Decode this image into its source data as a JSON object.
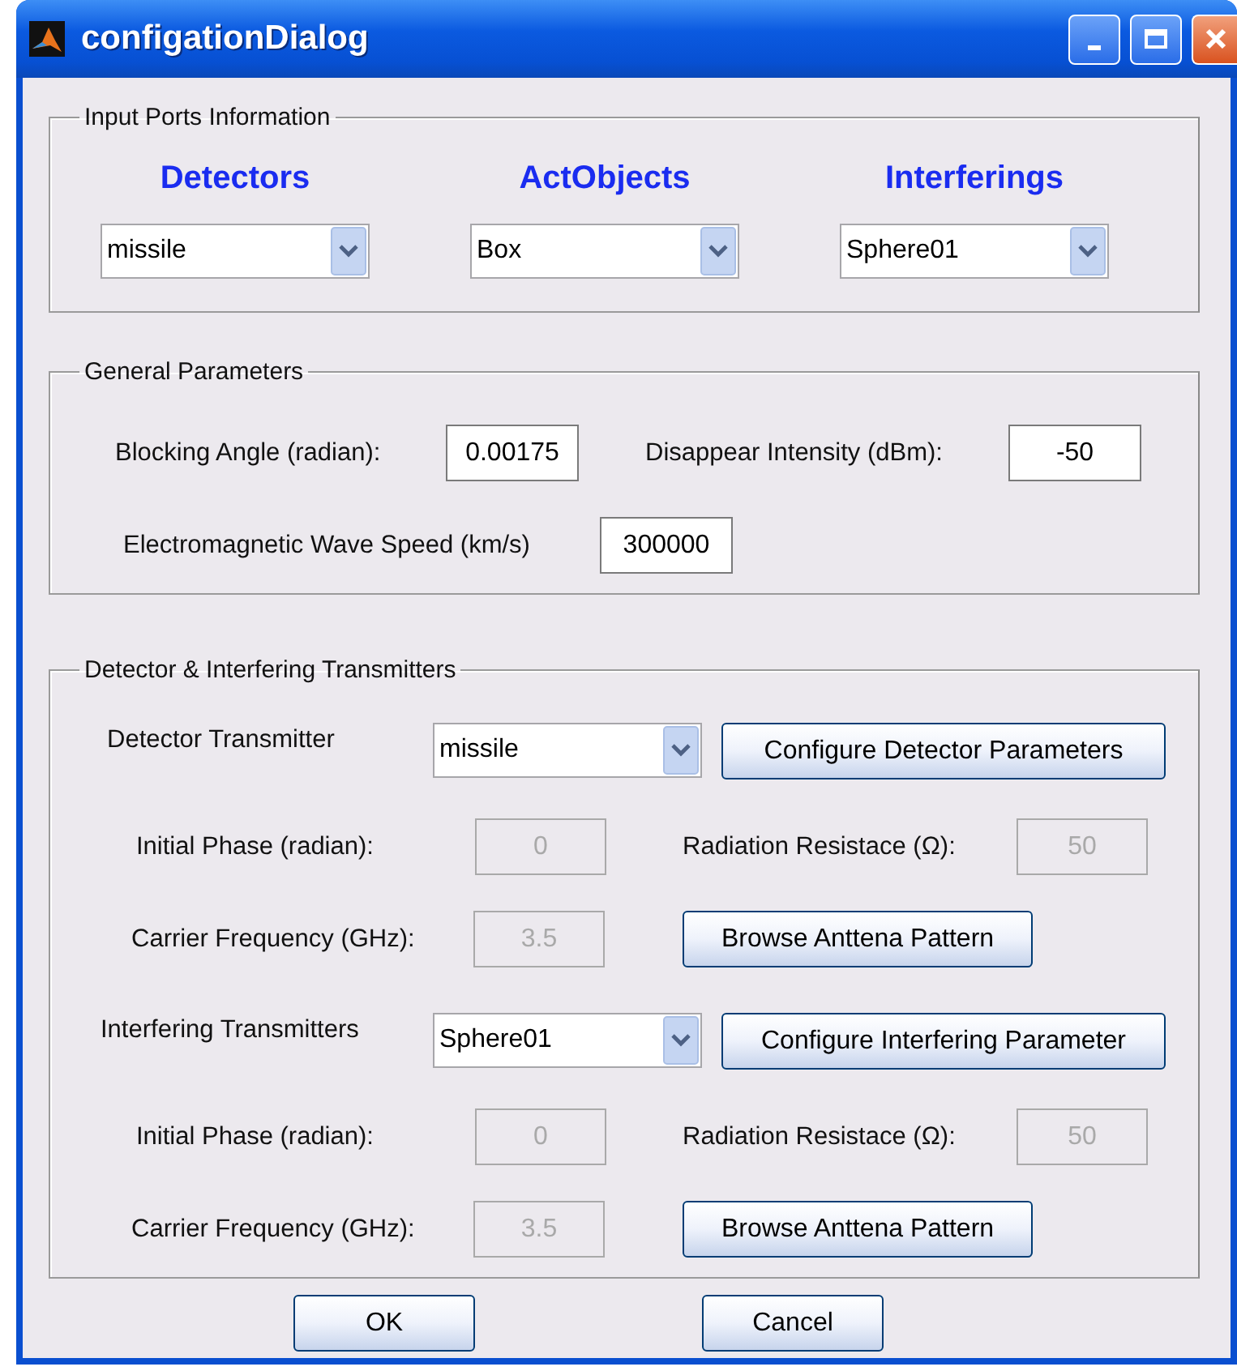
{
  "window": {
    "title": "configationDialog"
  },
  "input_ports": {
    "title": "Input Ports Information",
    "columns": [
      {
        "heading": "Detectors",
        "value": "missile"
      },
      {
        "heading": "ActObjects",
        "value": "Box"
      },
      {
        "heading": "Interferings",
        "value": "Sphere01"
      }
    ]
  },
  "general": {
    "title": "General Parameters",
    "fields": [
      {
        "label": "Blocking Angle (radian):",
        "value": "0.00175",
        "disabled": false
      },
      {
        "label": "Disappear Intensity (dBm):",
        "value": "-50",
        "disabled": false
      },
      {
        "label": "Electromagnetic Wave Speed (km/s)",
        "value": "300000",
        "disabled": false
      }
    ]
  },
  "transmitters": {
    "title": "Detector & Interfering Transmitters",
    "sections": [
      {
        "label": "Detector Transmitter",
        "value": "missile",
        "button": "Configure Detector Parameters",
        "phase": {
          "label": "Initial Phase (radian):",
          "value": "0",
          "disabled": true
        },
        "resistance": {
          "label": "Radiation Resistace (Ω):",
          "value": "50",
          "disabled": true
        },
        "frequency": {
          "label": "Carrier Frequency (GHz):",
          "value": "3.5",
          "disabled": true
        },
        "browse_button": "Browse Anttena Pattern"
      },
      {
        "label": "Interfering Transmitters",
        "value": "Sphere01",
        "button": "Configure Interfering Parameter",
        "phase": {
          "label": "Initial Phase (radian):",
          "value": "0",
          "disabled": true
        },
        "resistance": {
          "label": "Radiation Resistace (Ω):",
          "value": "50",
          "disabled": true
        },
        "frequency": {
          "label": "Carrier Frequency (GHz):",
          "value": "3.5",
          "disabled": true
        },
        "browse_button": "Browse Anttena Pattern"
      }
    ]
  },
  "buttons": [
    "OK",
    "Cancel"
  ]
}
